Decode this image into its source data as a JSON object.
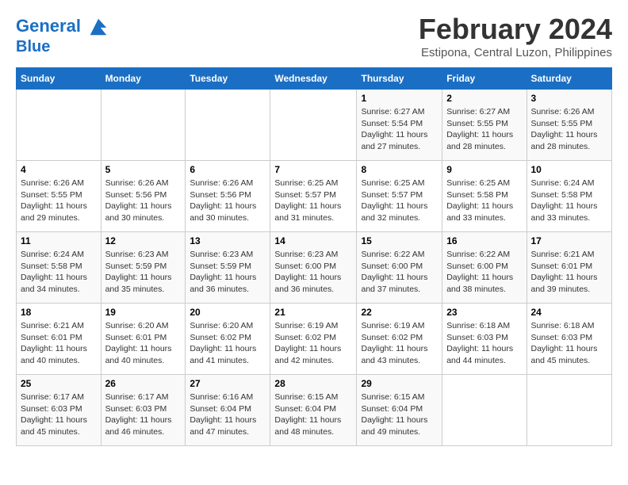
{
  "header": {
    "logo_line1": "General",
    "logo_line2": "Blue",
    "month": "February 2024",
    "location": "Estipona, Central Luzon, Philippines"
  },
  "weekdays": [
    "Sunday",
    "Monday",
    "Tuesday",
    "Wednesday",
    "Thursday",
    "Friday",
    "Saturday"
  ],
  "weeks": [
    [
      {
        "day": "",
        "info": ""
      },
      {
        "day": "",
        "info": ""
      },
      {
        "day": "",
        "info": ""
      },
      {
        "day": "",
        "info": ""
      },
      {
        "day": "1",
        "info": "Sunrise: 6:27 AM\nSunset: 5:54 PM\nDaylight: 11 hours and 27 minutes."
      },
      {
        "day": "2",
        "info": "Sunrise: 6:27 AM\nSunset: 5:55 PM\nDaylight: 11 hours and 28 minutes."
      },
      {
        "day": "3",
        "info": "Sunrise: 6:26 AM\nSunset: 5:55 PM\nDaylight: 11 hours and 28 minutes."
      }
    ],
    [
      {
        "day": "4",
        "info": "Sunrise: 6:26 AM\nSunset: 5:55 PM\nDaylight: 11 hours and 29 minutes."
      },
      {
        "day": "5",
        "info": "Sunrise: 6:26 AM\nSunset: 5:56 PM\nDaylight: 11 hours and 30 minutes."
      },
      {
        "day": "6",
        "info": "Sunrise: 6:26 AM\nSunset: 5:56 PM\nDaylight: 11 hours and 30 minutes."
      },
      {
        "day": "7",
        "info": "Sunrise: 6:25 AM\nSunset: 5:57 PM\nDaylight: 11 hours and 31 minutes."
      },
      {
        "day": "8",
        "info": "Sunrise: 6:25 AM\nSunset: 5:57 PM\nDaylight: 11 hours and 32 minutes."
      },
      {
        "day": "9",
        "info": "Sunrise: 6:25 AM\nSunset: 5:58 PM\nDaylight: 11 hours and 33 minutes."
      },
      {
        "day": "10",
        "info": "Sunrise: 6:24 AM\nSunset: 5:58 PM\nDaylight: 11 hours and 33 minutes."
      }
    ],
    [
      {
        "day": "11",
        "info": "Sunrise: 6:24 AM\nSunset: 5:58 PM\nDaylight: 11 hours and 34 minutes."
      },
      {
        "day": "12",
        "info": "Sunrise: 6:23 AM\nSunset: 5:59 PM\nDaylight: 11 hours and 35 minutes."
      },
      {
        "day": "13",
        "info": "Sunrise: 6:23 AM\nSunset: 5:59 PM\nDaylight: 11 hours and 36 minutes."
      },
      {
        "day": "14",
        "info": "Sunrise: 6:23 AM\nSunset: 6:00 PM\nDaylight: 11 hours and 36 minutes."
      },
      {
        "day": "15",
        "info": "Sunrise: 6:22 AM\nSunset: 6:00 PM\nDaylight: 11 hours and 37 minutes."
      },
      {
        "day": "16",
        "info": "Sunrise: 6:22 AM\nSunset: 6:00 PM\nDaylight: 11 hours and 38 minutes."
      },
      {
        "day": "17",
        "info": "Sunrise: 6:21 AM\nSunset: 6:01 PM\nDaylight: 11 hours and 39 minutes."
      }
    ],
    [
      {
        "day": "18",
        "info": "Sunrise: 6:21 AM\nSunset: 6:01 PM\nDaylight: 11 hours and 40 minutes."
      },
      {
        "day": "19",
        "info": "Sunrise: 6:20 AM\nSunset: 6:01 PM\nDaylight: 11 hours and 40 minutes."
      },
      {
        "day": "20",
        "info": "Sunrise: 6:20 AM\nSunset: 6:02 PM\nDaylight: 11 hours and 41 minutes."
      },
      {
        "day": "21",
        "info": "Sunrise: 6:19 AM\nSunset: 6:02 PM\nDaylight: 11 hours and 42 minutes."
      },
      {
        "day": "22",
        "info": "Sunrise: 6:19 AM\nSunset: 6:02 PM\nDaylight: 11 hours and 43 minutes."
      },
      {
        "day": "23",
        "info": "Sunrise: 6:18 AM\nSunset: 6:03 PM\nDaylight: 11 hours and 44 minutes."
      },
      {
        "day": "24",
        "info": "Sunrise: 6:18 AM\nSunset: 6:03 PM\nDaylight: 11 hours and 45 minutes."
      }
    ],
    [
      {
        "day": "25",
        "info": "Sunrise: 6:17 AM\nSunset: 6:03 PM\nDaylight: 11 hours and 45 minutes."
      },
      {
        "day": "26",
        "info": "Sunrise: 6:17 AM\nSunset: 6:03 PM\nDaylight: 11 hours and 46 minutes."
      },
      {
        "day": "27",
        "info": "Sunrise: 6:16 AM\nSunset: 6:04 PM\nDaylight: 11 hours and 47 minutes."
      },
      {
        "day": "28",
        "info": "Sunrise: 6:15 AM\nSunset: 6:04 PM\nDaylight: 11 hours and 48 minutes."
      },
      {
        "day": "29",
        "info": "Sunrise: 6:15 AM\nSunset: 6:04 PM\nDaylight: 11 hours and 49 minutes."
      },
      {
        "day": "",
        "info": ""
      },
      {
        "day": "",
        "info": ""
      }
    ]
  ]
}
